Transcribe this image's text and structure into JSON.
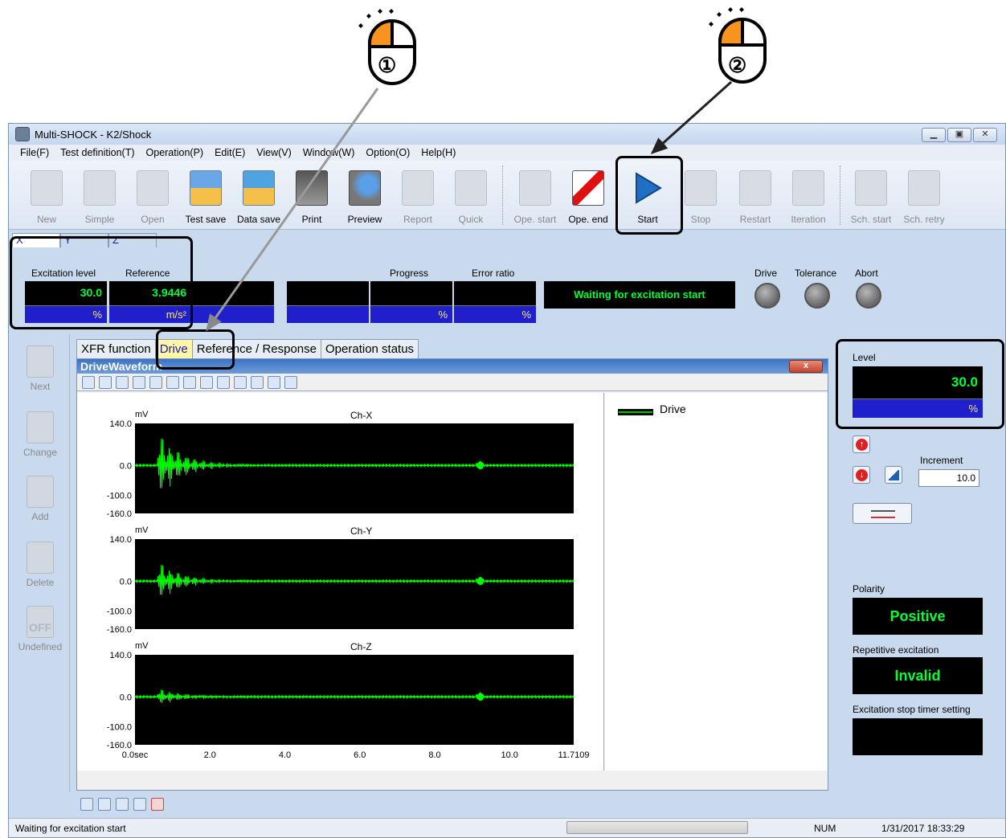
{
  "window": {
    "title": "Multi-SHOCK - K2/Shock"
  },
  "menu": [
    "File(F)",
    "Test definition(T)",
    "Operation(P)",
    "Edit(E)",
    "View(V)",
    "Window(W)",
    "Option(O)",
    "Help(H)"
  ],
  "toolbar": {
    "new": "New",
    "simple": "Simple",
    "open": "Open",
    "test_save": "Test save",
    "data_save": "Data save",
    "print": "Print",
    "preview": "Preview",
    "report": "Report",
    "quick": "Quick",
    "ope_start": "Ope. start",
    "ope_end": "Ope. end",
    "start": "Start",
    "stop": "Stop",
    "restart": "Restart",
    "iteration": "Iteration",
    "sch_start": "Sch. start",
    "sch_retry": "Sch. retry"
  },
  "axis_tabs": [
    "X",
    "Y",
    "Z"
  ],
  "meters": {
    "excitation_label": "Excitation level",
    "excitation_value": "30.0",
    "excitation_unit": "%",
    "reference_label": "Reference",
    "reference_value": "3.9446",
    "reference_unit": "m/s²",
    "progress_label": "Progress",
    "progress_unit": "%",
    "error_label": "Error ratio",
    "error_unit": "%",
    "status_text": "Waiting for excitation start"
  },
  "lamps": {
    "drive": "Drive",
    "tolerance": "Tolerance",
    "abort": "Abort"
  },
  "side": {
    "next": "Next",
    "change": "Change",
    "add": "Add",
    "delete": "Delete",
    "undefined": "Undefined",
    "off_glyph": "OFF"
  },
  "tabs": [
    "XFR function",
    "Drive",
    "Reference / Response",
    "Operation status"
  ],
  "drive_window": {
    "title": "DriveWaveform",
    "close": "x"
  },
  "chart_data": {
    "type": "line",
    "series": [
      {
        "name": "Drive"
      }
    ],
    "channels": [
      "Ch-X",
      "Ch-Y",
      "Ch-Z"
    ],
    "unit": "mV",
    "y_ticks": [
      "140.0",
      "0.0",
      "-100.0",
      "-160.0"
    ],
    "x_ticks": [
      "0.0sec",
      "2.0",
      "4.0",
      "6.0",
      "8.0",
      "10.0",
      "11.7109"
    ],
    "xlim": [
      0,
      11.7109
    ],
    "ylim": [
      -160,
      140
    ],
    "grid": false,
    "legend": "right"
  },
  "right": {
    "level_label": "Level",
    "level_value": "30.0",
    "level_unit": "%",
    "increment_label": "Increment",
    "increment_value": "10.0",
    "polarity_label": "Polarity",
    "polarity_value": "Positive",
    "repetitive_label": "Repetitive excitation",
    "repetitive_value": "Invalid",
    "timer_label": "Excitation stop timer setting"
  },
  "statusbar": {
    "message": "Waiting for excitation start",
    "num": "NUM",
    "datetime": "1/31/2017  18:33:29"
  },
  "markers": {
    "one": "①",
    "two": "②"
  },
  "colors": {
    "trace": "#00ff00",
    "meter_value": "#00ff33",
    "meter_unit_bg": "#1f1fcc",
    "accent_orange": "#f7931e"
  }
}
